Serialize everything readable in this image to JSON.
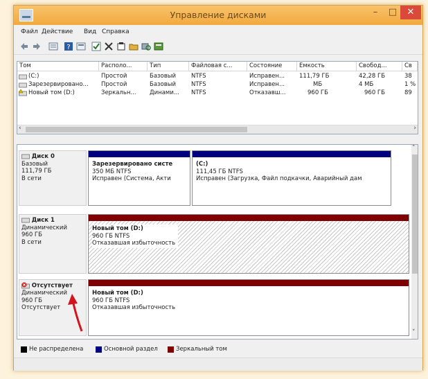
{
  "window": {
    "title": "Управление дисками",
    "minimize": "–",
    "maximize": "□",
    "close": "✕"
  },
  "menu": [
    "Файл",
    "Действие",
    "Вид",
    "Справка"
  ],
  "toolbar_icons": [
    "back-icon",
    "forward-icon",
    "list-view-icon",
    "help-icon",
    "console-icon",
    "check-icon",
    "delete-icon",
    "properties-icon",
    "folder-open-icon",
    "search-disk-icon",
    "volume-view-icon"
  ],
  "volumes": {
    "headers": [
      "Том",
      "Располо...",
      "Тип",
      "Файловая с...",
      "Состояние",
      "Емкость",
      "Свобод...",
      "Св"
    ],
    "rows": [
      [
        "(C:)",
        "Простой",
        "Базовый",
        "NTFS",
        "Исправен...",
        "111,79 ГБ",
        "42,28 ГБ",
        "38"
      ],
      [
        "Зарезервировано...",
        "Простой",
        "Базовый",
        "NTFS",
        "Исправен...",
        "МБ",
        "4 МБ",
        "1 %"
      ],
      [
        "Новый том (D:)",
        "Зеркальн...",
        "Динами...",
        "NTFS",
        "Отказавш...",
        "960 ГБ",
        "960 ГБ",
        "89"
      ]
    ]
  },
  "disks": [
    {
      "name": "Диск 0",
      "type": "Базовый",
      "size": "111,79 ГБ",
      "status": "В сети",
      "partitions": [
        {
          "title": "Зарезервировано систе",
          "size": "350 МБ NTFS",
          "state": "Исправен (Система, Акти"
        },
        {
          "title": "(C:)",
          "size": "111,45 ГБ NTFS",
          "state": "Исправен (Загрузка, Файл подкачки, Аварийный дам"
        }
      ]
    },
    {
      "name": "Диск 1",
      "type": "Динамический",
      "size": "960 ГБ",
      "status": "В сети",
      "partitions": [
        {
          "title": "Новый том (D:)",
          "size": "960 ГБ NTFS",
          "state": "Отказавшая избыточность"
        }
      ]
    },
    {
      "name": "Отсутствует",
      "type": "Динамический",
      "size": "960 ГБ",
      "status": "Отсутствует",
      "partitions": [
        {
          "title": "Новый том (D:)",
          "size": "960 ГБ NTFS",
          "state": "Отказавшая избыточность"
        }
      ]
    }
  ],
  "legend": [
    {
      "label": "Не распределена",
      "color": "#000000"
    },
    {
      "label": "Основной раздел",
      "color": "#00007f"
    },
    {
      "label": "Зеркальный том",
      "color": "#7f0000"
    }
  ],
  "colors": {
    "primary": "#00007f",
    "mirror": "#7f0000",
    "unallocated": "#000000",
    "accent_arrow": "#d2141e"
  }
}
